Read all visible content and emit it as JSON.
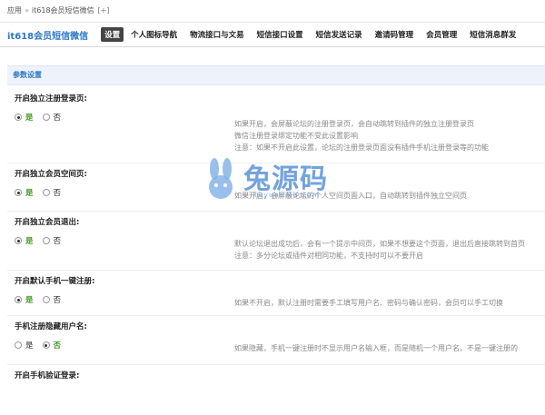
{
  "breadcrumb": {
    "root": "应用",
    "sep": "»",
    "current": "it618会员短信微信",
    "pin": "[+]"
  },
  "nav": {
    "brand": "it618会员短信微信",
    "tabs": [
      "设置",
      "个人图标导航",
      "物流接口与文易",
      "短信接口设置",
      "短信发送记录",
      "邀请码管理",
      "会员管理",
      "短信消息群发"
    ],
    "active_index": 0
  },
  "panel": {
    "title": "参数设置"
  },
  "sections": [
    {
      "title": "开启独立注册登录页:",
      "options": [
        "是",
        "否"
      ],
      "selected": 0,
      "desc": [
        "如果开启，会屏蔽论坛的注册登录页，会自动跳转到插件的独立注册登录页",
        "微信注册登录绑定功能不受此设置影响",
        "注意：如果不开启此设置，论坛的注册登录页面没有插件手机注册登录等的功能"
      ]
    },
    {
      "title": "开启独立会员空间页:",
      "options": [
        "是",
        "否"
      ],
      "selected": 0,
      "desc": [
        "如果开启，会屏蔽论坛的个人空间页面入口，自动跳转到插件独立空间页"
      ]
    },
    {
      "title": "开启独立会员退出:",
      "options": [
        "是",
        "否"
      ],
      "selected": 0,
      "desc": [
        "默认论坛退出成功后，会有一个提示中间页，如果不想要这个页面，退出后直接跳转到首页",
        "注意：多分论坛或插件对相同功能，不支持时可以不要开启"
      ]
    },
    {
      "title": "开启默认手机一键注册:",
      "options": [
        "是",
        "否"
      ],
      "selected": 0,
      "desc": [
        "如果不开启，默认注册时需要手工填写用户名、密码与确认密码，会员可以手工切换"
      ]
    },
    {
      "title": "手机注册隐藏用户名:",
      "options": [
        "是",
        "否"
      ],
      "selected": 1,
      "desc": [
        "如果隐藏，手机一键注册时不显示用户名输入框，而是随机一个用户名，不是一键注册的"
      ]
    },
    {
      "title": "开启手机验证登录:",
      "options": [],
      "selected": -1,
      "desc": []
    }
  ],
  "watermark": {
    "main": "兔源码",
    "sub": "tuyuanma.com"
  },
  "colors": {
    "accent": "#2b78c7",
    "selected": "#4a9a2a",
    "watermark": "#5b93d6"
  }
}
